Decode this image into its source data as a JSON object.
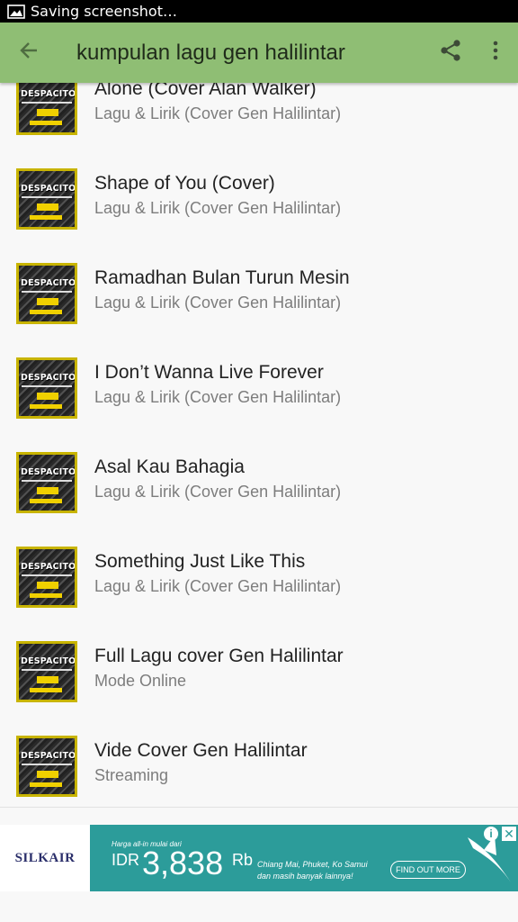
{
  "status_bar": {
    "text": "Saving screenshot…",
    "icon": "image-icon"
  },
  "app_bar": {
    "title": "kumpulan lagu gen halilintar",
    "back_icon": "arrow-left-icon",
    "share_icon": "share-icon",
    "menu_icon": "more-vert-icon",
    "color": "#8fbe74"
  },
  "thumbnail": {
    "label": "DESPACITO"
  },
  "items": [
    {
      "title": "Alone (Cover Alan Walker)",
      "subtitle": "Lagu & Lirik (Cover Gen Halilintar)"
    },
    {
      "title": "Shape of You (Cover)",
      "subtitle": "Lagu & Lirik (Cover Gen Halilintar)"
    },
    {
      "title": "Ramadhan Bulan Turun Mesin",
      "subtitle": "Lagu & Lirik (Cover Gen Halilintar)"
    },
    {
      "title": "I Don’t Wanna Live Forever",
      "subtitle": "Lagu & Lirik (Cover Gen Halilintar)"
    },
    {
      "title": "Asal Kau Bahagia",
      "subtitle": "Lagu & Lirik (Cover Gen Halilintar)"
    },
    {
      "title": "Something Just Like This",
      "subtitle": "Lagu & Lirik (Cover Gen Halilintar)"
    },
    {
      "title": "Full Lagu cover Gen Halilintar",
      "subtitle": "Mode Online"
    },
    {
      "title": "Vide Cover Gen Halilintar",
      "subtitle": "Streaming"
    }
  ],
  "ad": {
    "brand": "SILKAIR",
    "small_text": "Harga all-in mulai dari",
    "currency": "IDR",
    "price": "3,838",
    "unit": "Rb",
    "destinations": "Chiang Mai, Phuket, Ko Samui dan masih banyak lainnya!",
    "cta": "FIND OUT MORE",
    "info_icon": "info-icon",
    "close_icon": "close-icon",
    "color": "#2c9c9a"
  }
}
